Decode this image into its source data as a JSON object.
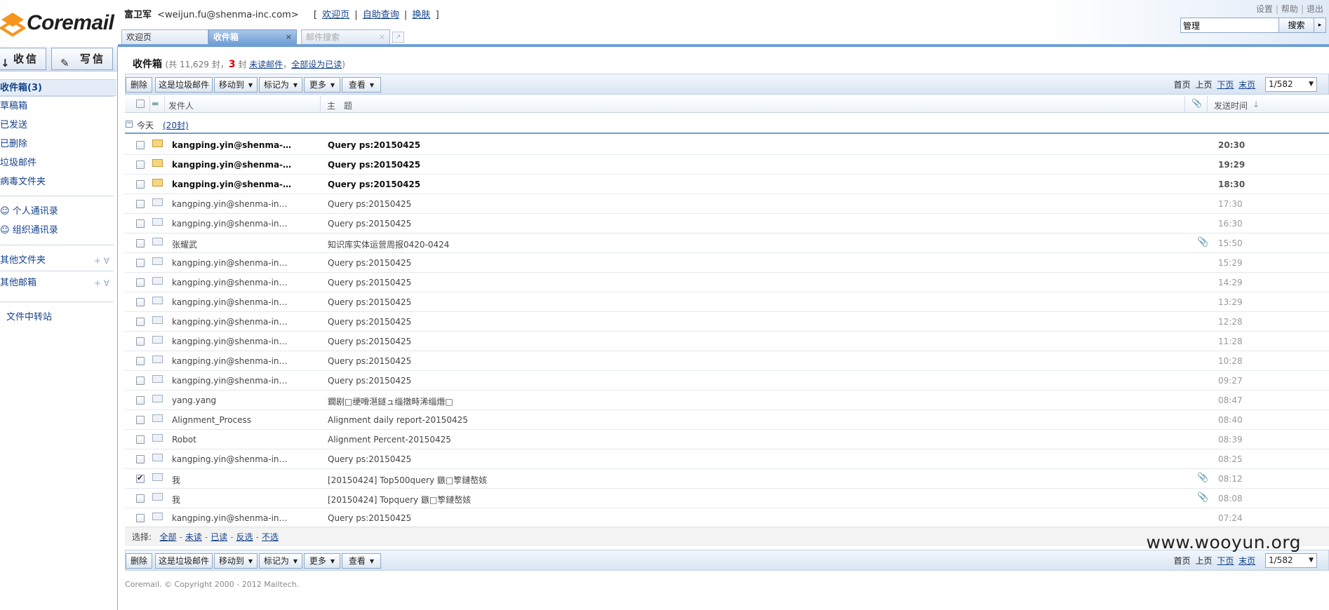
{
  "header": {
    "logo_text": "Coremail",
    "user_name": "富卫军",
    "user_email": "<weijun.fu@shenma-inc.com>",
    "links": [
      "欢迎页",
      "自助查询",
      "换肤"
    ],
    "top_right_links": [
      "设置",
      "帮助",
      "退出"
    ],
    "search_value": "管理",
    "search_button": "搜索",
    "search_arrow": "▸",
    "tabs": [
      {
        "label": "欢迎页",
        "close": ""
      },
      {
        "label": "收件箱",
        "close": "×"
      },
      {
        "label": "邮件搜索",
        "close": "×"
      }
    ],
    "new_tab_icon": "↗"
  },
  "sidebar": {
    "receive_label": "收信",
    "write_label": "写信",
    "receive_icon": "↓",
    "write_icon": "✎",
    "folders": [
      "收件箱(3)",
      "草稿箱",
      "已发送",
      "已删除",
      "垃圾邮件",
      "病毒文件夹"
    ],
    "contacts": [
      "个人通讯录",
      "组织通讯录"
    ],
    "other_folders": "其他文件夹",
    "other_mailboxes": "其他邮箱",
    "extra_icons": "+ ∀",
    "file_transfer": "文件中转站"
  },
  "main": {
    "folder_name": "收件箱",
    "count_prefix": "(共 11,629 封，",
    "unread_count": "3",
    "unread_suffix": " 封 ",
    "unread_link": "未读邮件",
    "comma": "，",
    "mark_all_link": "全部设为已读",
    "close_paren": ")",
    "toolbar": {
      "delete": "删除",
      "spam": "这是垃圾邮件",
      "move_to": "移动到",
      "mark_as": "标记为",
      "more": "更多",
      "view": "查看",
      "caret": "▼"
    },
    "pager": {
      "first": "首页",
      "prev": "上页",
      "next": "下页",
      "last": "末页",
      "page": "1/582",
      "arrow": "▼"
    },
    "columns": {
      "from": "发件人",
      "subject": "主　题",
      "attachment_icon": "📎",
      "time": "发送时间",
      "sort_icon": "↓"
    },
    "group": {
      "toggle": "−",
      "label": "今天",
      "count": "(20封)"
    },
    "rows": [
      {
        "from": "kangping.yin@shenma-in...",
        "subject": "Query ps:20150425",
        "time": "20:30",
        "unread": true,
        "attach": "",
        "checked": false
      },
      {
        "from": "kangping.yin@shenma-in...",
        "subject": "Query ps:20150425",
        "time": "19:29",
        "unread": true,
        "attach": "",
        "checked": false
      },
      {
        "from": "kangping.yin@shenma-in...",
        "subject": "Query ps:20150425",
        "time": "18:30",
        "unread": true,
        "attach": "",
        "checked": false
      },
      {
        "from": "kangping.yin@shenma-inc.com",
        "subject": "Query ps:20150425",
        "time": "17:30",
        "unread": false,
        "attach": "",
        "checked": false
      },
      {
        "from": "kangping.yin@shenma-inc.com",
        "subject": "Query ps:20150425",
        "time": "16:30",
        "unread": false,
        "attach": "",
        "checked": false
      },
      {
        "from": "张耀武",
        "subject": "知识库实体运营周报0420-0424",
        "time": "15:50",
        "unread": false,
        "attach": "📎",
        "checked": false
      },
      {
        "from": "kangping.yin@shenma-inc.com",
        "subject": "Query ps:20150425",
        "time": "15:29",
        "unread": false,
        "attach": "",
        "checked": false
      },
      {
        "from": "kangping.yin@shenma-inc.com",
        "subject": "Query ps:20150425",
        "time": "14:29",
        "unread": false,
        "attach": "",
        "checked": false
      },
      {
        "from": "kangping.yin@shenma-inc.com",
        "subject": "Query ps:20150425",
        "time": "13:29",
        "unread": false,
        "attach": "",
        "checked": false
      },
      {
        "from": "kangping.yin@shenma-inc.com",
        "subject": "Query ps:20150425",
        "time": "12:28",
        "unread": false,
        "attach": "",
        "checked": false
      },
      {
        "from": "kangping.yin@shenma-inc.com",
        "subject": "Query ps:20150425",
        "time": "11:28",
        "unread": false,
        "attach": "",
        "checked": false
      },
      {
        "from": "kangping.yin@shenma-inc.com",
        "subject": "Query ps:20150425",
        "time": "10:28",
        "unread": false,
        "attach": "",
        "checked": false
      },
      {
        "from": "kangping.yin@shenma-inc.com",
        "subject": "Query ps:20150425",
        "time": "09:27",
        "unread": false,
        "attach": "",
        "checked": false
      },
      {
        "from": "yang.yang",
        "subject": "鐗剧□绠嗗潖鐩ュ缁撴畤浠缁熸□",
        "time": "08:47",
        "unread": false,
        "attach": "",
        "checked": false
      },
      {
        "from": "Alignment_Process",
        "subject": "Alignment daily report-20150425",
        "time": "08:40",
        "unread": false,
        "attach": "",
        "checked": false
      },
      {
        "from": "Robot",
        "subject": "Alignment Percent-20150425",
        "time": "08:39",
        "unread": false,
        "attach": "",
        "checked": false
      },
      {
        "from": "kangping.yin@shenma-inc.com",
        "subject": "Query ps:20150425",
        "time": "08:25",
        "unread": false,
        "attach": "",
        "checked": false
      },
      {
        "from": "我",
        "subject": "[20150424] Top500query 鏃□箰鏈嶅姟",
        "time": "08:12",
        "unread": false,
        "attach": "📎",
        "checked": true
      },
      {
        "from": "我",
        "subject": "[20150424] Topquery 鏃□箰鏈嶅姟",
        "time": "08:08",
        "unread": false,
        "attach": "📎",
        "checked": false
      },
      {
        "from": "kangping.yin@shenma-inc.com",
        "subject": "Query ps:20150425",
        "time": "07:24",
        "unread": false,
        "attach": "",
        "checked": false
      }
    ],
    "select_bar": {
      "label": "选择:",
      "options": [
        "全部",
        "未读",
        "已读",
        "反选",
        "不选"
      ],
      "sep": "-"
    },
    "footer": "Coremail. © Copyright 2000 - 2012 Mailtech."
  },
  "watermark": "www.wooyun.org",
  "colors": {
    "accent": "#6f9fd5",
    "link": "#15428b",
    "unread_count": "#dd0000"
  }
}
